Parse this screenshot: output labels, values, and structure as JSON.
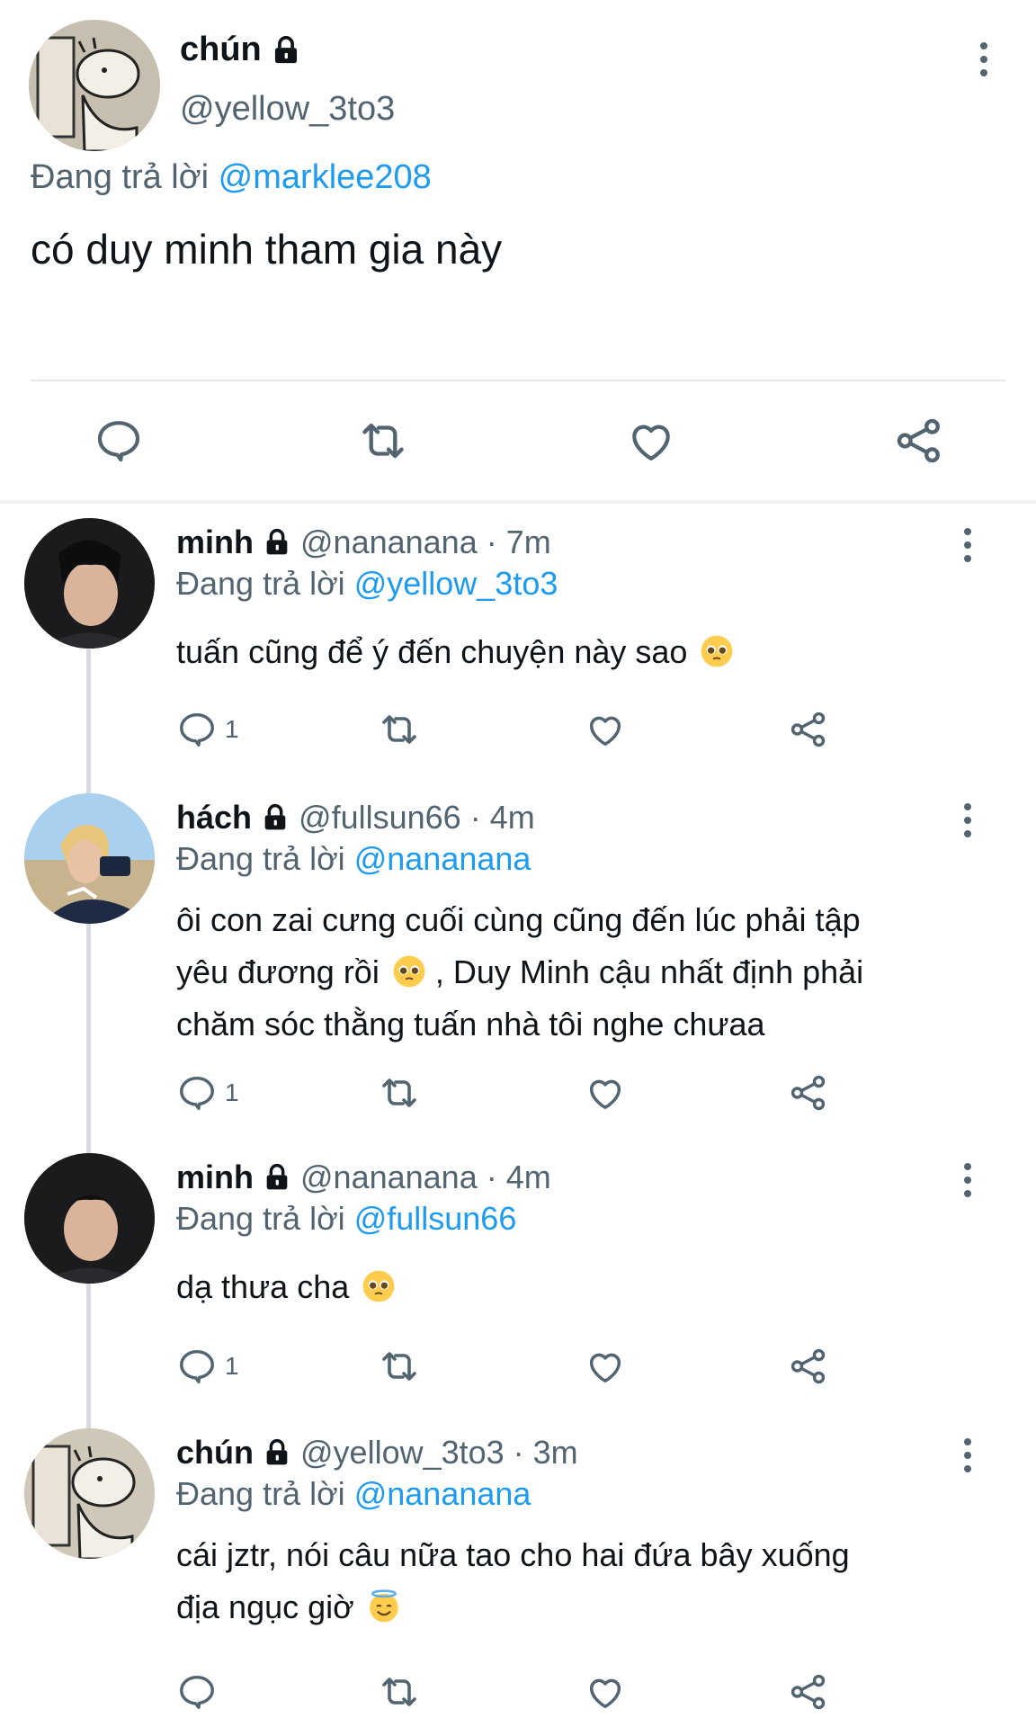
{
  "main_tweet": {
    "display_name": "chún",
    "handle": "@yellow_3to3",
    "replying_prefix": "Đang trả lời",
    "replying_to": "@marklee208",
    "text": "có duy minh tham gia này"
  },
  "replies": [
    {
      "display_name": "minh",
      "handle": "@nananana",
      "time": "· 7m",
      "replying_prefix": "Đang trả lời",
      "replying_to": "@yellow_3to3",
      "text": "tuấn cũng để ý đến chuyện này sao",
      "emoji": "pleading-face",
      "reply_count": "1"
    },
    {
      "display_name": "hách",
      "handle": "@fullsun66",
      "time": "· 4m",
      "replying_prefix": "Đang trả lời",
      "replying_to": "@nananana",
      "text_line1": "ôi con zai cưng cuối cùng cũng đến lúc phải tập",
      "text_line2a": "yêu đương rồi",
      "text_line2b": ", Duy Minh cậu nhất định phải",
      "text_line3": "chăm sóc thằng tuấn nhà tôi nghe chưaa",
      "emoji": "pleading-face",
      "reply_count": "1"
    },
    {
      "display_name": "minh",
      "handle": "@nananana",
      "time": "· 4m",
      "replying_prefix": "Đang trả lời",
      "replying_to": "@fullsun66",
      "text": "dạ thưa cha",
      "emoji": "pleading-face",
      "reply_count": "1"
    },
    {
      "display_name": "chún",
      "handle": "@yellow_3to3",
      "time": "· 3m",
      "replying_prefix": "Đang trả lời",
      "replying_to": "@nananana",
      "text_line1": "cái jztr, nói câu nữa tao cho hai đứa bây xuống",
      "text_line2": "địa ngục giờ",
      "emoji": "smiling-face-with-halo"
    }
  ],
  "colors": {
    "link": "#1d9bf0",
    "secondary_text": "#536471",
    "primary_text": "#0f1419"
  }
}
